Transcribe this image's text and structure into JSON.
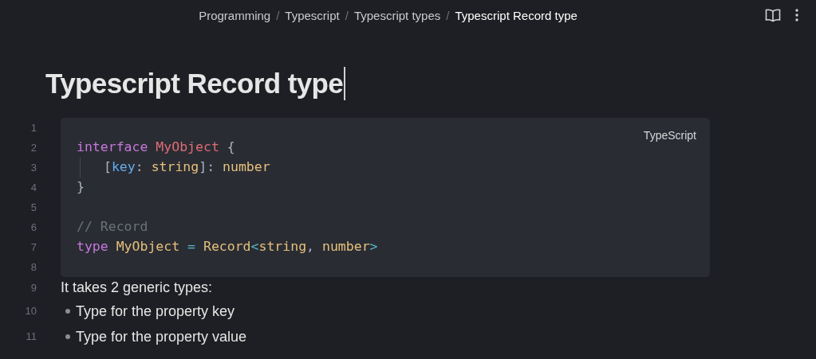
{
  "breadcrumb": [
    {
      "kind": "item",
      "text": "Programming"
    },
    {
      "kind": "separator",
      "text": "/"
    },
    {
      "kind": "item",
      "text": "Typescript"
    },
    {
      "kind": "separator",
      "text": "/"
    },
    {
      "kind": "item",
      "text": "Typescript types"
    },
    {
      "kind": "separator",
      "text": "/"
    },
    {
      "kind": "item",
      "text": "Typescript Record type",
      "current": true
    }
  ],
  "title": "Typescript Record type",
  "code_block": {
    "language": "TypeScript",
    "lines": [
      {
        "number": "1"
      },
      {
        "number": "2",
        "tokens": [
          {
            "text": "interface ",
            "kind": "keyword"
          },
          {
            "text": "MyObject",
            "kind": "name"
          },
          {
            "text": " {",
            "kind": "punct"
          }
        ]
      },
      {
        "number": "3",
        "indent_guide": true,
        "tokens": [
          {
            "text": "[",
            "kind": "punct"
          },
          {
            "text": "key",
            "kind": "property"
          },
          {
            "text": ": ",
            "kind": "punct"
          },
          {
            "text": "string",
            "kind": "type"
          },
          {
            "text": "]: ",
            "kind": "punct"
          },
          {
            "text": "number",
            "kind": "type"
          }
        ]
      },
      {
        "number": "4",
        "tokens": [
          {
            "text": "}",
            "kind": "punct"
          }
        ]
      },
      {
        "number": "5"
      },
      {
        "number": "6",
        "tokens": [
          {
            "text": "// Record",
            "kind": "comment"
          }
        ]
      },
      {
        "number": "7",
        "tokens": [
          {
            "text": "type ",
            "kind": "keyword"
          },
          {
            "text": "MyObject ",
            "kind": "type"
          },
          {
            "text": "= ",
            "kind": "operator"
          },
          {
            "text": "Record",
            "kind": "type"
          },
          {
            "text": "<",
            "kind": "operator"
          },
          {
            "text": "string",
            "kind": "type"
          },
          {
            "text": ", ",
            "kind": "punct"
          },
          {
            "text": "number",
            "kind": "type"
          },
          {
            "text": ">",
            "kind": "operator"
          }
        ]
      },
      {
        "number": "8"
      }
    ]
  },
  "body": [
    {
      "number": "9",
      "kind": "paragraph",
      "text": "It takes 2 generic types:"
    },
    {
      "number": "10",
      "kind": "bullet",
      "text": "Type for the property key"
    },
    {
      "number": "11",
      "kind": "bullet",
      "text": "Type for the property value"
    }
  ]
}
